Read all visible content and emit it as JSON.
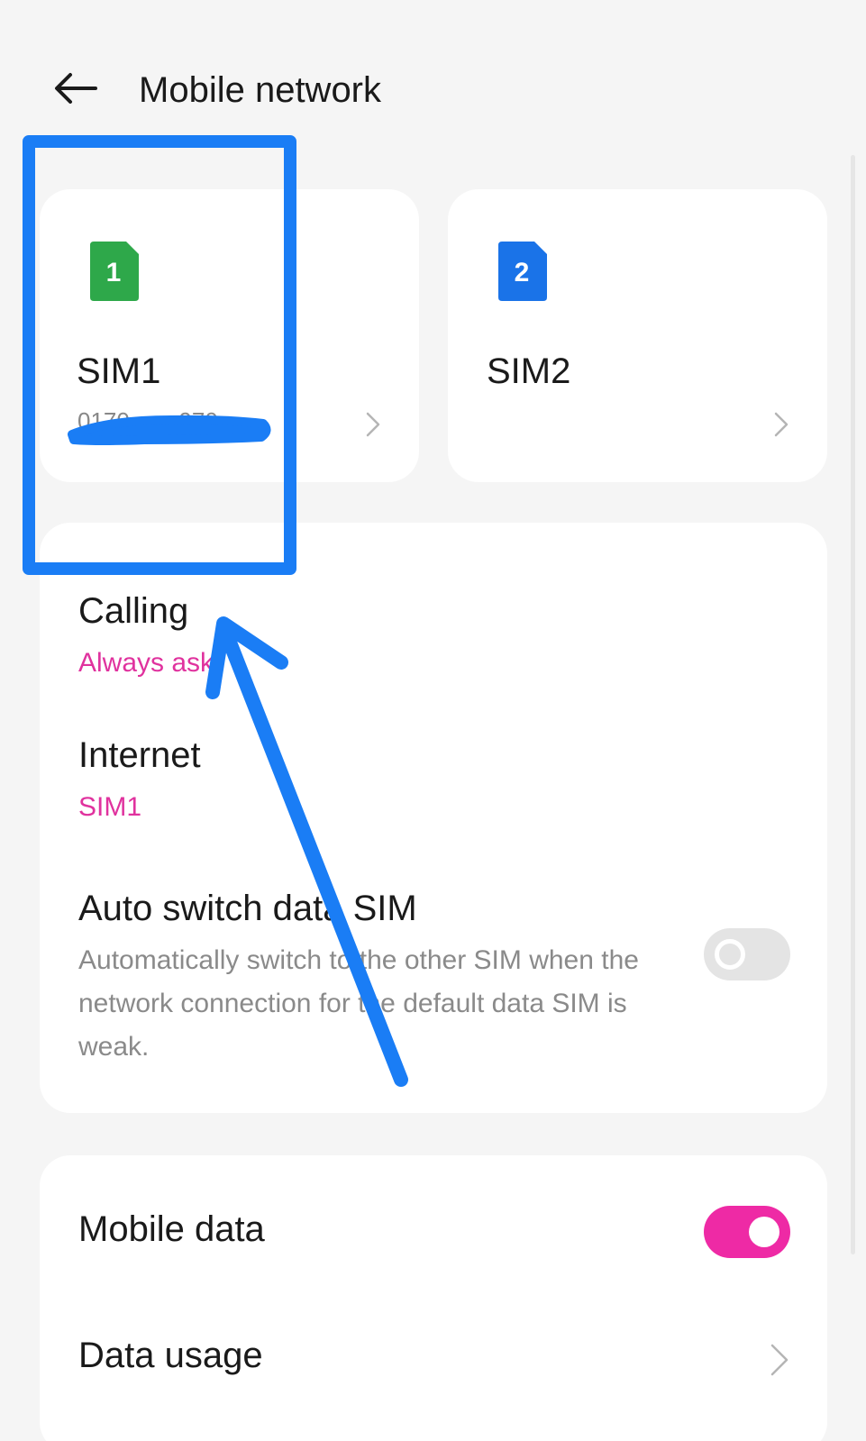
{
  "header": {
    "title": "Mobile network",
    "back_icon": "arrow-left-icon"
  },
  "sims": [
    {
      "name": "SIM1",
      "badge": "1",
      "color": "#2ea84a",
      "number": "0170••••••970"
    },
    {
      "name": "SIM2",
      "badge": "2",
      "color": "#1a73e8",
      "number": ""
    }
  ],
  "settings": {
    "calling": {
      "title": "Calling",
      "value": "Always ask"
    },
    "internet": {
      "title": "Internet",
      "value": "SIM1"
    },
    "auto_switch": {
      "title": "Auto switch data SIM",
      "description": "Automatically switch to the other SIM when the network connection for the default data SIM is weak.",
      "enabled": false
    }
  },
  "data": {
    "mobile_data": {
      "title": "Mobile data",
      "enabled": true
    },
    "data_usage": {
      "title": "Data usage"
    }
  },
  "colors": {
    "accent": "#ee2aa5",
    "annotation": "#1a7df5"
  }
}
